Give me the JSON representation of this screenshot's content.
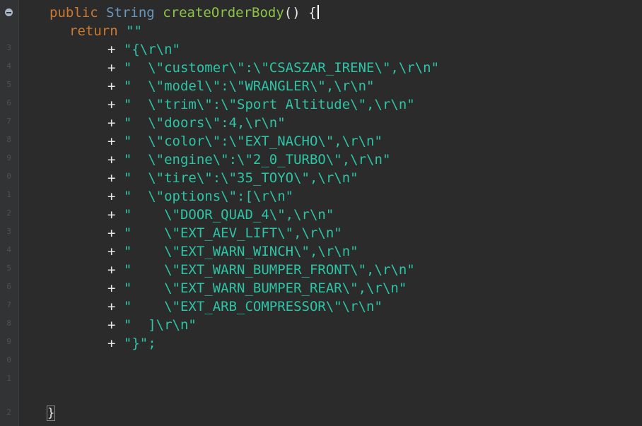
{
  "gutter": {
    "line_numbers": [
      "1",
      "2",
      "3",
      "4",
      "5",
      "6",
      "7",
      "8",
      "9",
      "0",
      "1",
      "2",
      "3",
      "4",
      "5",
      "6",
      "7",
      "8",
      "9",
      "0",
      "1",
      "2"
    ]
  },
  "signature": {
    "modifier": "public",
    "type": "String",
    "method": "createOrderBody",
    "parens_brace": "() {"
  },
  "return_line": {
    "keyword": "return",
    "literal": "\"\""
  },
  "lines": [
    {
      "plus": "+ ",
      "text": "\"{\\r\\n\""
    },
    {
      "plus": "+ ",
      "text": "\"  \\\"customer\\\":\\\"CSASZAR_IRENE\\\",\\r\\n\""
    },
    {
      "plus": "+ ",
      "text": "\"  \\\"model\\\":\\\"WRANGLER\\\",\\r\\n\""
    },
    {
      "plus": "+ ",
      "text": "\"  \\\"trim\\\":\\\"Sport Altitude\\\",\\r\\n\""
    },
    {
      "plus": "+ ",
      "text": "\"  \\\"doors\\\":4,\\r\\n\""
    },
    {
      "plus": "+ ",
      "text": "\"  \\\"color\\\":\\\"EXT_NACHO\\\",\\r\\n\""
    },
    {
      "plus": "+ ",
      "text": "\"  \\\"engine\\\":\\\"2_0_TURBO\\\",\\r\\n\""
    },
    {
      "plus": "+ ",
      "text": "\"  \\\"tire\\\":\\\"35_TOYO\\\",\\r\\n\""
    },
    {
      "plus": "+ ",
      "text": "\"  \\\"options\\\":[\\r\\n\""
    },
    {
      "plus": "+ ",
      "text": "\"    \\\"DOOR_QUAD_4\\\",\\r\\n\""
    },
    {
      "plus": "+ ",
      "text": "\"    \\\"EXT_AEV_LIFT\\\",\\r\\n\""
    },
    {
      "plus": "+ ",
      "text": "\"    \\\"EXT_WARN_WINCH\\\",\\r\\n\""
    },
    {
      "plus": "+ ",
      "text": "\"    \\\"EXT_WARN_BUMPER_FRONT\\\",\\r\\n\""
    },
    {
      "plus": "+ ",
      "text": "\"    \\\"EXT_WARN_BUMPER_REAR\\\",\\r\\n\""
    },
    {
      "plus": "+ ",
      "text": "\"    \\\"EXT_ARB_COMPRESSOR\\\"\\r\\n\""
    },
    {
      "plus": "+ ",
      "text": "\"  ]\\r\\n\""
    },
    {
      "plus": "+ ",
      "text": "\"}\";"
    }
  ],
  "closing": {
    "brace": "}"
  },
  "colors": {
    "background": "#2b2b2b",
    "keyword": "#cc7832",
    "type": "#6897bb",
    "method": "#8bc34a",
    "string": "#2ec4a6"
  }
}
